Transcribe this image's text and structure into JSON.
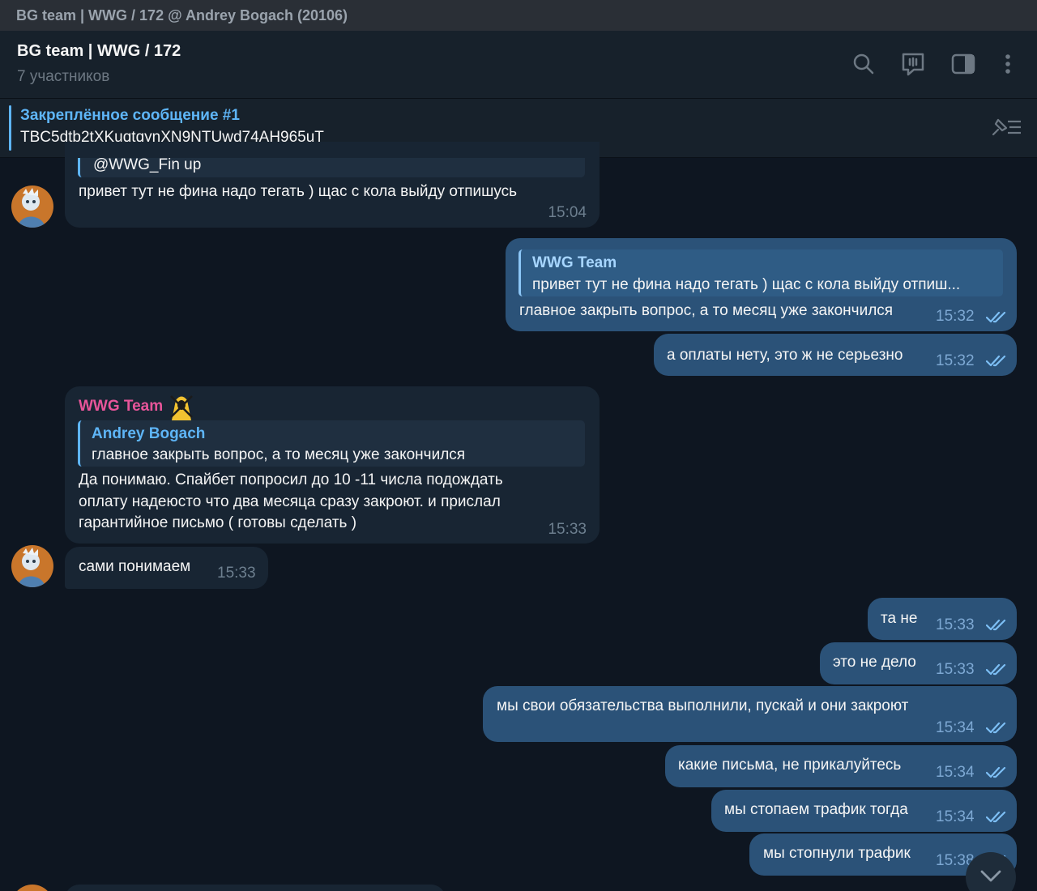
{
  "window": {
    "title": "BG team | WWG / 172 @ Andrey Bogach (20106)"
  },
  "header": {
    "title": "BG team | WWG / 172",
    "subtitle": "7 участников",
    "icons": [
      "search-icon",
      "live-stream-icon",
      "sidebar-toggle-icon",
      "more-icon"
    ]
  },
  "pinned": {
    "title": "Закреплённое сообщение #1",
    "text": "TBC5dtb2tXKuqtqynXN9NTUwd74AH965uT",
    "icon": "pin-list-icon"
  },
  "colors": {
    "accent": "#5eb5f7",
    "incoming": "#182533",
    "outgoing": "#2b5278",
    "sender_name": "#e8559a",
    "background": "#0e1621"
  },
  "messages": [
    {
      "id": "m1",
      "direction": "in",
      "reply": {
        "name": "",
        "text": "@WWG_Fin up"
      },
      "text": "привет тут не фина надо тегать ) щас с кола выйду отпишусь",
      "time": "15:04"
    },
    {
      "id": "m2",
      "direction": "out",
      "reply": {
        "name": "WWG Team",
        "text": "привет тут не фина надо тегать ) щас с кола выйду отпиш..."
      },
      "text": "главное закрыть вопрос, а то месяц уже закончился",
      "time": "15:32",
      "read": true
    },
    {
      "id": "m3",
      "direction": "out",
      "text": "а оплаты нету, это ж не серьезно",
      "time": "15:32",
      "read": true
    },
    {
      "id": "m4",
      "direction": "in",
      "sender": "WWG Team",
      "reply": {
        "name": "Andrey Bogach",
        "text": "главное закрыть вопрос, а то месяц уже закончился"
      },
      "lines": [
        "Да понимаю. Спайбет попросил до 10 -11 числа подождать",
        "оплату надеюсто что два месяца сразу закроют. и прислал",
        "гарантийное письмо ( готовы сделать )"
      ],
      "time": "15:33"
    },
    {
      "id": "m5",
      "direction": "in",
      "text": "сами понимаем",
      "time": "15:33"
    },
    {
      "id": "m6",
      "direction": "out",
      "text": "та не",
      "time": "15:33",
      "read": true
    },
    {
      "id": "m7",
      "direction": "out",
      "text": "это не дело",
      "time": "15:33",
      "read": true
    },
    {
      "id": "m8",
      "direction": "out",
      "text": "мы свои обязательства выполнили, пускай и они закроют",
      "time": "15:34",
      "read": true
    },
    {
      "id": "m9",
      "direction": "out",
      "text": "какие письма, не прикалуйтесь",
      "time": "15:34",
      "read": true
    },
    {
      "id": "m10",
      "direction": "out",
      "text": "мы стопаем трафик тогда",
      "time": "15:34",
      "read": true
    },
    {
      "id": "m11",
      "direction": "out",
      "text": "мы стопнули трафик",
      "time": "15:38",
      "read": true
    }
  ]
}
